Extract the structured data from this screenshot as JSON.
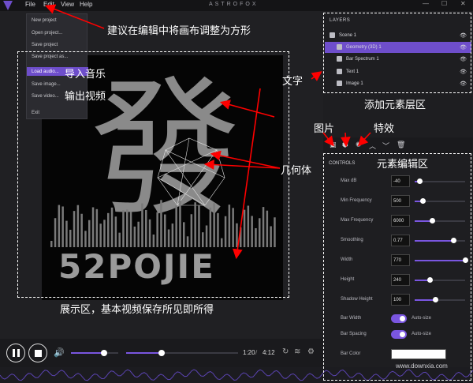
{
  "menubar": {
    "file": "File",
    "edit": "Edit",
    "view": "View",
    "help": "Help",
    "app_title": "ASTROFOX",
    "win_min": "—",
    "win_max": "☐",
    "win_close": "✕"
  },
  "file_menu": {
    "items": [
      "New project",
      "Open project...",
      "Save project",
      "Save project as...",
      "Load audio...",
      "Save image...",
      "Save video...",
      "Exit"
    ]
  },
  "canvas": {
    "big_text": "52POJIE",
    "brush_glyph": "發"
  },
  "layers": {
    "title": "LAYERS",
    "items": [
      {
        "label": "Scene 1",
        "icon": "scene-icon"
      },
      {
        "label": "Geometry (3D) 1",
        "icon": "cube-icon",
        "selected": true
      },
      {
        "label": "Bar Spectrum 1",
        "icon": "bar-spectrum-icon"
      },
      {
        "label": "Text 1",
        "icon": "text-icon"
      },
      {
        "label": "Image 1",
        "icon": "image-icon"
      }
    ]
  },
  "controls": {
    "title": "CONTROLS",
    "rows": [
      {
        "label": "Max dB",
        "value": "-40",
        "fill": 0.1
      },
      {
        "label": "Min Frequency",
        "value": "500",
        "fill": 0.15
      },
      {
        "label": "Max Frequency",
        "value": "6000",
        "fill": 0.35
      },
      {
        "label": "Smoothing",
        "value": "0.77",
        "fill": 0.77
      },
      {
        "label": "Width",
        "value": "770",
        "fill": 1.0
      },
      {
        "label": "Height",
        "value": "240",
        "fill": 0.3
      },
      {
        "label": "Shadow Height",
        "value": "100",
        "fill": 0.4
      }
    ],
    "toggles": [
      {
        "label": "Bar Width",
        "text": "Auto-size"
      },
      {
        "label": "Bar Spacing",
        "text": "Auto-size"
      }
    ],
    "bar_color": "Bar Color",
    "shadow_color": "Shadow Color"
  },
  "player": {
    "time_current": "1:20",
    "time_sep": "/",
    "time_total": "4:12",
    "volume": 0.7,
    "progress": 0.32
  },
  "annotations": {
    "canvas_square": "建议在编辑中将画布调整为方形",
    "import_music": "导入音乐",
    "export_video": "输出视频",
    "text_label": "文字",
    "add_layer": "添加元素层区",
    "image_label": "图片",
    "effects_label": "特效",
    "geometry_label": "几何体",
    "edit_area": "元素编辑区",
    "display_area": "展示区，基本视频保存所见即所得"
  },
  "watermark": "www.downxia.com",
  "colors": {
    "accent": "#6e4ecb",
    "annotation": "#ff0000"
  }
}
